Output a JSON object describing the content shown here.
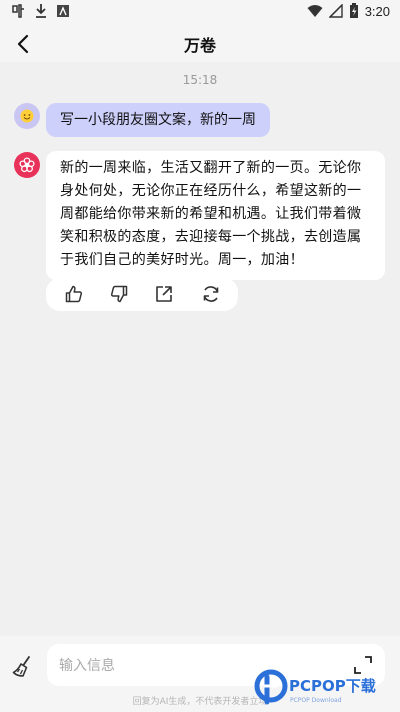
{
  "status_bar": {
    "time": "3:20",
    "left_icons": [
      "app-notification-icon",
      "download-icon",
      "app-icon"
    ],
    "right_icons": [
      "wifi-icon",
      "signal-icon",
      "battery-icon"
    ]
  },
  "header": {
    "title": "万卷",
    "back_icon": "chevron-left-icon"
  },
  "conversation": {
    "timestamp": "15:18",
    "user_message": "写一小段朋友圈文案，新的一周",
    "bot_message": "新的一周来临，生活又翻开了新的一页。无论你身处何处，无论你正在经历什么，希望这新的一周都能给你带来新的希望和机遇。让我们带着微笑和积极的态度，去迎接每一个挑战，去创造属于我们自己的美好时光。周一，加油！",
    "actions": [
      "thumbs-up-icon",
      "thumbs-down-icon",
      "share-icon",
      "refresh-icon"
    ]
  },
  "composer": {
    "placeholder": "输入信息",
    "left_icon": "broom-icon",
    "right_icon": "expand-icon"
  },
  "disclaimer": "回复为AI生成，不代表开发者立场",
  "watermark": {
    "brand": "PCPOP下载",
    "sub": "PCPOP Download"
  },
  "colors": {
    "background": "#f0f0f0",
    "user_bubble": "#cdd0fb",
    "bot_avatar": "#e8325a",
    "watermark_blue": "#2b6fd8"
  }
}
